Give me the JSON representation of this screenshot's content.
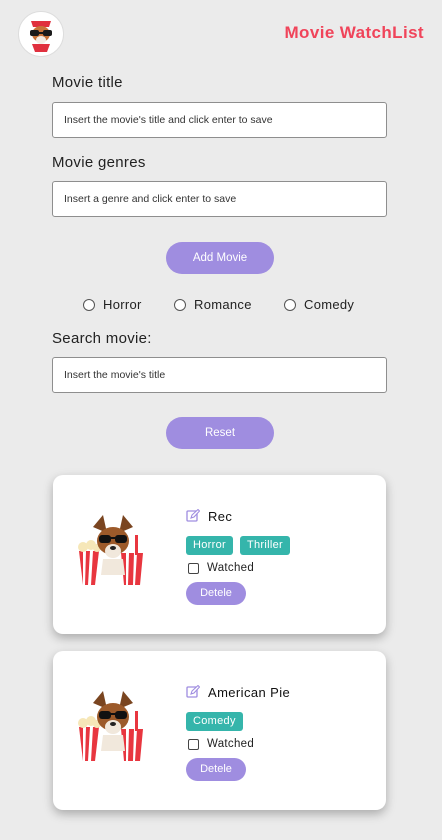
{
  "header": {
    "title": "Movie WatchList",
    "logo_icon": "dog-with-sunglasses-icon"
  },
  "form": {
    "title_label": "Movie title",
    "title_placeholder": "Insert the movie's title and click enter to save",
    "genre_label": "Movie genres",
    "genre_placeholder": "Insert a genre and click enter to save",
    "add_button": "Add Movie"
  },
  "filters": {
    "options": [
      "Horror",
      "Romance",
      "Comedy"
    ]
  },
  "search": {
    "label": "Search movie:",
    "placeholder": "Insert the movie's title",
    "reset_button": "Reset"
  },
  "movies": [
    {
      "title": "Rec",
      "genres": [
        "Horror",
        "Thriller"
      ],
      "watched_label": "Watched",
      "delete_label": "Detele"
    },
    {
      "title": "American Pie",
      "genres": [
        "Comedy"
      ],
      "watched_label": "Watched",
      "delete_label": "Detele"
    }
  ],
  "colors": {
    "accent": "#f0445a",
    "button": "#9f8de0",
    "tag": "#35b5ab",
    "background": "#ebebeb"
  }
}
